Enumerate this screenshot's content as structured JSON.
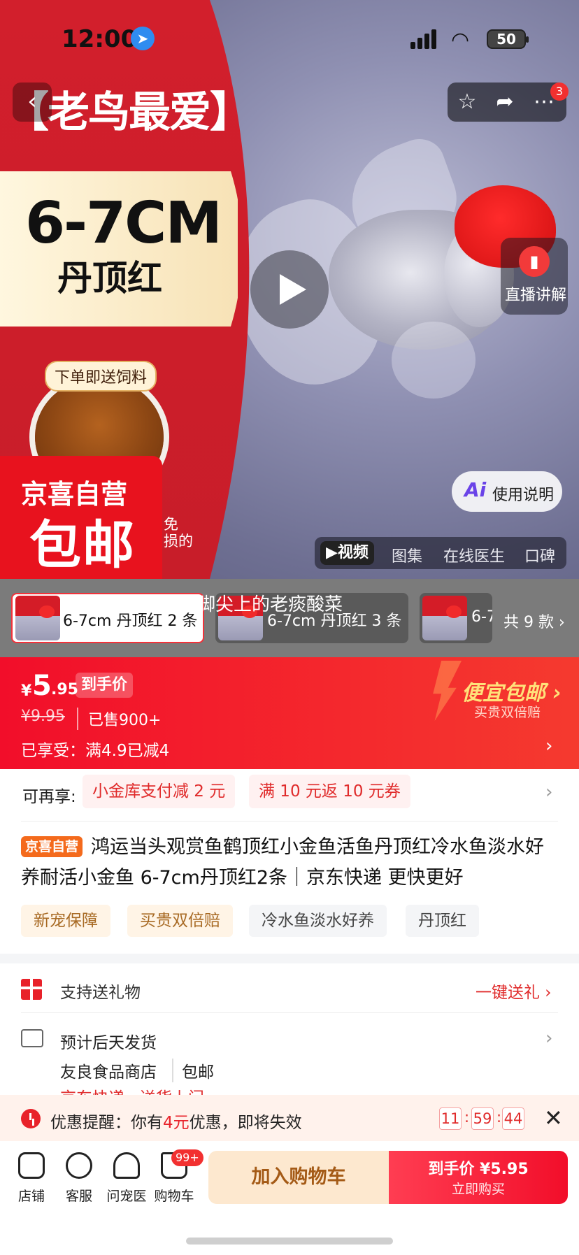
{
  "status_bar": {
    "time": "12:00",
    "battery": "50"
  },
  "hero": {
    "promo_title": "【老鸟最爱】",
    "promo_size": "6-7CM",
    "promo_name": "丹顶红",
    "feed_badge": "下单即送饲料",
    "jx_line1": "京喜自营",
    "jx_line2": "包邮",
    "small_note_1": "免",
    "small_note_2": "损的",
    "notification_count": "3",
    "live_label": "直播讲解",
    "usage_ai": "Ai",
    "usage_label": "使用说明",
    "media_tabs": [
      "▶视频",
      "图集",
      "在线医生",
      "口碑"
    ]
  },
  "variants": {
    "overlay_text": "脚尖上的老痰酸菜",
    "items": [
      "6-7cm 丹顶红 2 条",
      "6-7cm 丹顶红 3 条",
      "6-7"
    ],
    "total": "共 9 款 ›"
  },
  "price": {
    "yen": "¥",
    "main": "5",
    "decimal": ".95",
    "tag": "到手价",
    "original": "¥9.95",
    "sold": "已售900+",
    "enjoyed": "已享受：满4.9已减4",
    "cheap_badge": "便宜包邮 ›",
    "cheap_sub": "买贵双倍赔",
    "arrow": "›"
  },
  "coupons": {
    "label": "可再享:",
    "items": [
      "小金库支付减 2 元",
      "满 10 元返 10 元券"
    ],
    "arrow": "›"
  },
  "product": {
    "self_tag": "京喜自营",
    "title": "鸿运当头观赏鱼鹤顶红小金鱼活鱼丹顶红冷水鱼淡水好养耐活小金鱼 6-7cm丹顶红2条｜京东快递 更快更好",
    "tags": [
      "新宠保障",
      "买贵双倍赔",
      "冷水鱼淡水好养",
      "丹顶红"
    ]
  },
  "services": {
    "gift_label": "支持送礼物",
    "gift_action": "一键送礼 ›",
    "ship_label": "预计后天发货",
    "ship_arrow": "›",
    "shop_name": "友良食品商店",
    "shop_free": "包邮",
    "express": "京东快递 · 送货上门"
  },
  "reminder": {
    "prefix": "优惠提醒：你有",
    "amount": "4元",
    "suffix": "优惠，即将失效",
    "timer": [
      "11",
      "59",
      "44"
    ],
    "close": "✕"
  },
  "bottom_bar": {
    "items": [
      "店铺",
      "客服",
      "问宠医",
      "购物车"
    ],
    "cart_badge": "99+",
    "add_cart": "加入购物车",
    "buy_top": "到手价 ¥5.95",
    "buy_sub": "立即购买"
  },
  "colors": {
    "accent_red": "#f20e2a",
    "jx_red": "#e8121e",
    "self_tag_orange": "#f46a1c"
  }
}
